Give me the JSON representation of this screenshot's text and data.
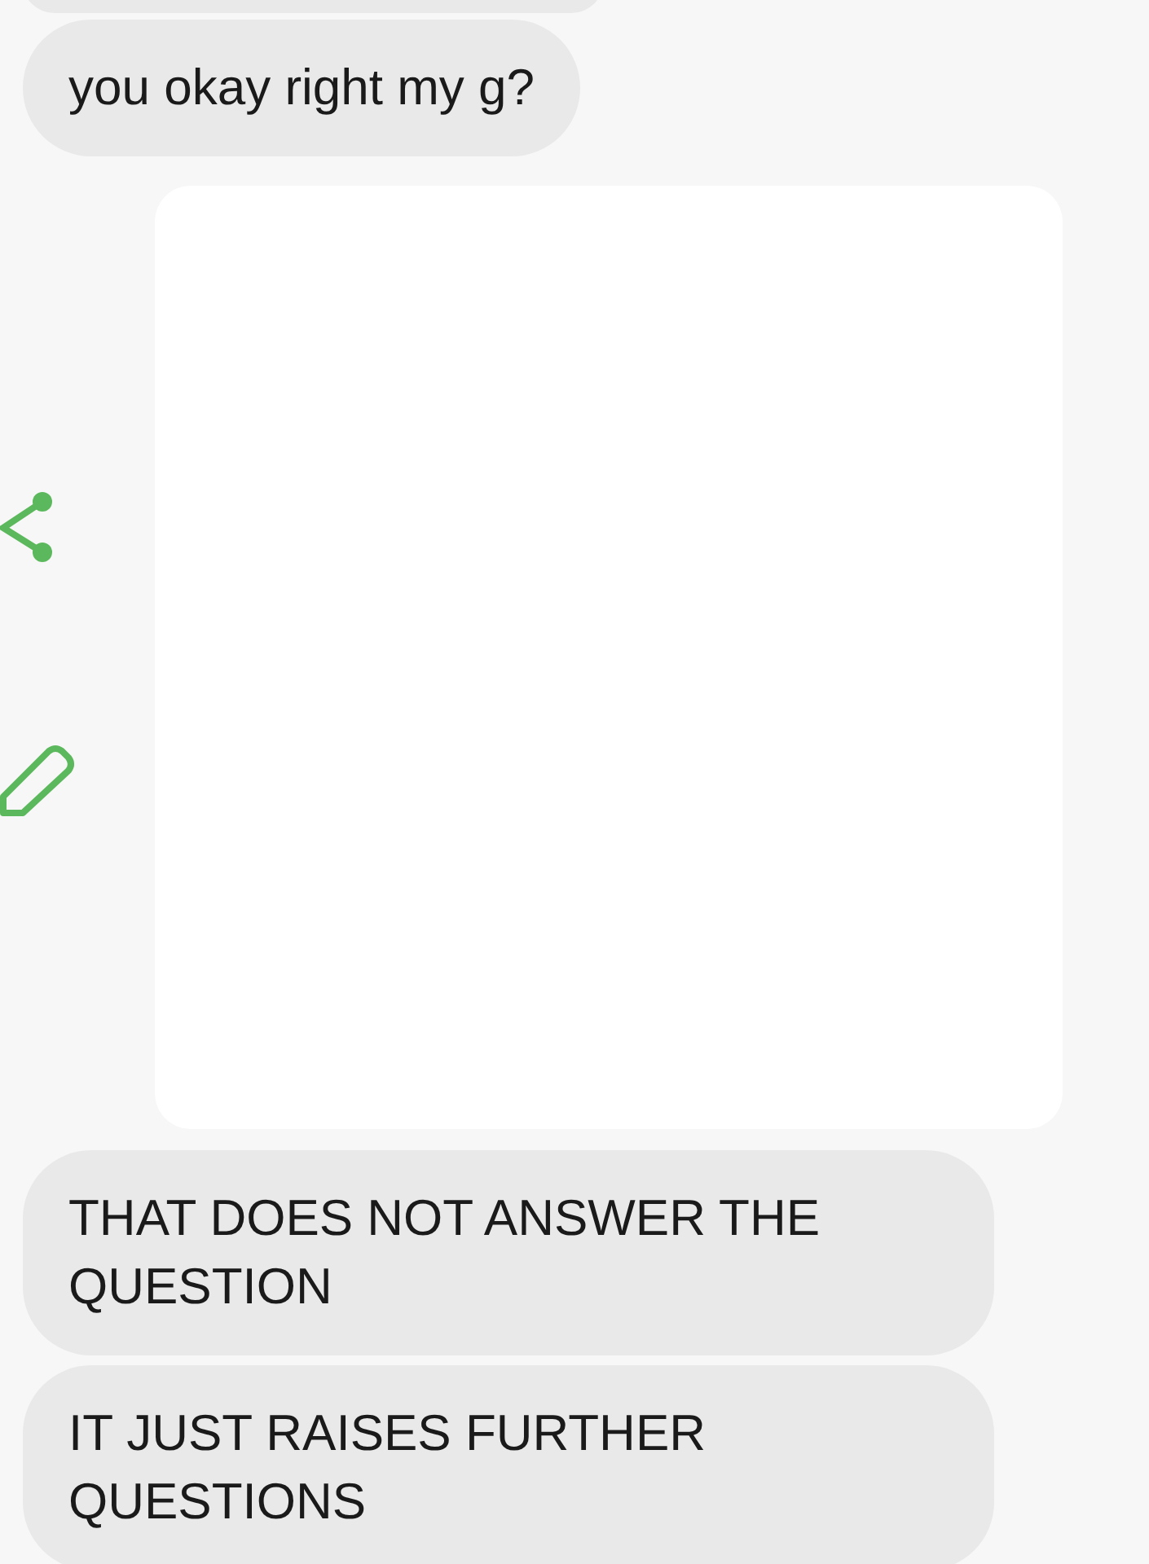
{
  "messages": [
    {
      "kind": "clipped"
    },
    {
      "kind": "text",
      "text": "you okay right my g?"
    },
    {
      "kind": "image",
      "actions": [
        {
          "kind": "share"
        },
        {
          "kind": "edit"
        }
      ]
    },
    {
      "kind": "text",
      "text": "THAT DOES NOT ANSWER THE QUESTION"
    },
    {
      "kind": "text",
      "text": "IT JUST RAISES FURTHER QUESTIONS"
    }
  ]
}
